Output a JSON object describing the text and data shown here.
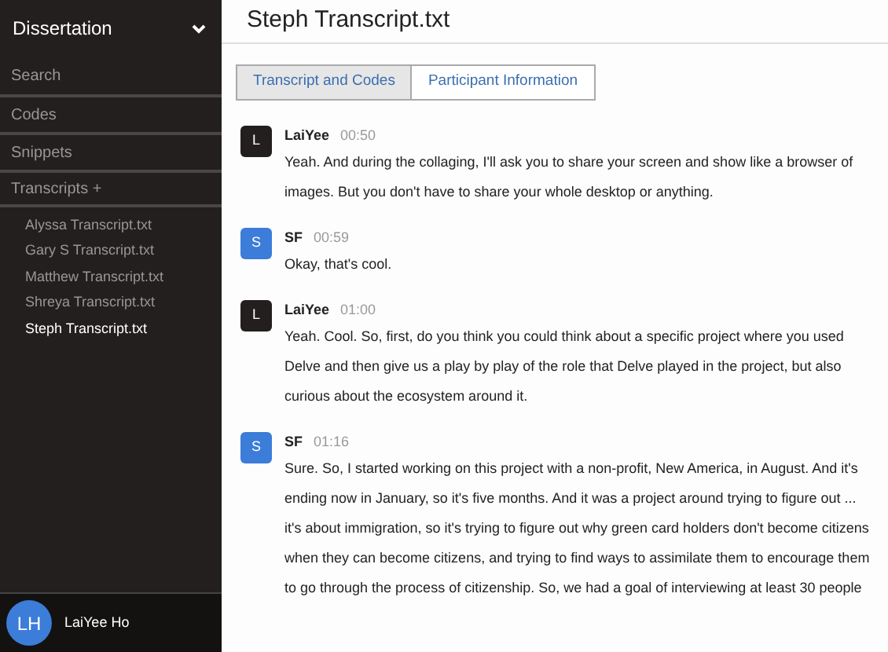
{
  "sidebar": {
    "project": "Dissertation",
    "nav": [
      {
        "label": "Search"
      },
      {
        "label": "Codes"
      },
      {
        "label": "Snippets"
      },
      {
        "label": "Transcripts +"
      }
    ],
    "files": [
      {
        "label": "Alyssa Transcript.txt",
        "selected": false
      },
      {
        "label": "Gary S Transcript.txt",
        "selected": false
      },
      {
        "label": "Matthew Transcript.txt",
        "selected": false
      },
      {
        "label": "Shreya Transcript.txt",
        "selected": false
      },
      {
        "label": "Steph Transcript.txt",
        "selected": true
      }
    ],
    "user": {
      "initials": "LH",
      "name": "LaiYee Ho"
    }
  },
  "title": "Steph Transcript.txt",
  "tabs": [
    {
      "label": "Transcript and Codes",
      "selected": true
    },
    {
      "label": "Participant Information",
      "selected": false
    }
  ],
  "messages": [
    {
      "initial": "L",
      "color": "#231f1e",
      "speaker": "LaiYee",
      "time": "00:50",
      "text": "Yeah. And during the collaging, I'll ask you to share your screen and show like a browser of images. But you don't have to share your whole desktop or anything."
    },
    {
      "initial": "S",
      "color": "#3b7dd8",
      "speaker": "SF",
      "time": "00:59",
      "text": "Okay, that's cool."
    },
    {
      "initial": "L",
      "color": "#231f1e",
      "speaker": "LaiYee",
      "time": "01:00",
      "text": "Yeah. Cool. So, first, do you think you could think about a specific project where you used Delve and then give us a play by play of the role that Delve played in the project, but also curious about the ecosystem around it."
    },
    {
      "initial": "S",
      "color": "#3b7dd8",
      "speaker": "SF",
      "time": "01:16",
      "text": "Sure. So, I started working on this project with a non-profit, New America, in August. And it's ending now in January, so it's five months. And it was a project around trying to figure out ... it's about immigration, so it's trying to figure out why green card holders don't become citizens when they can become citizens, and trying to find ways to assimilate them to encourage them to go through the process of citizenship. So, we had a goal of interviewing at least 30 people"
    }
  ]
}
